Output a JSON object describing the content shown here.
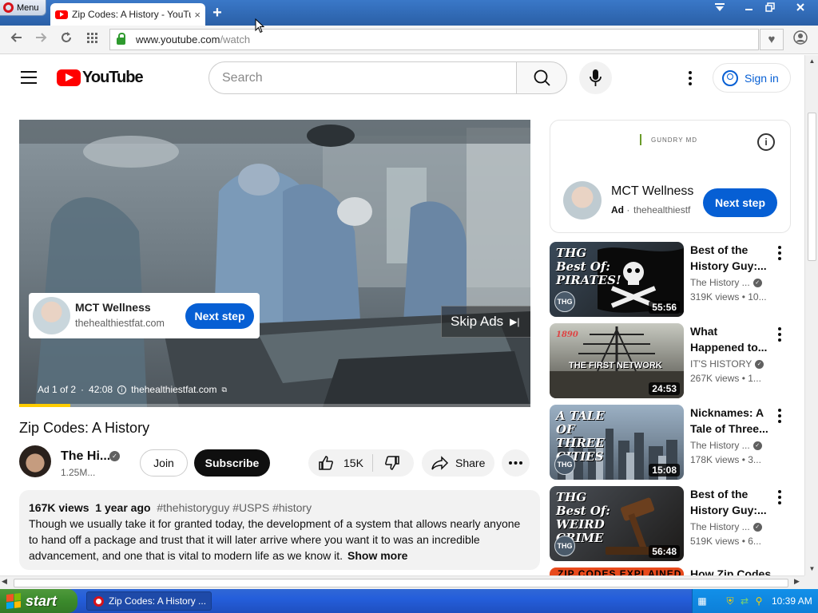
{
  "browser": {
    "menu_label": "Menu",
    "tab_title": "Zip Codes: A History - YouTu",
    "tab_close": "×",
    "new_tab": "+",
    "url_host": "www.youtube.com",
    "url_path": "/watch"
  },
  "youtube": {
    "logo_text": "YouTube",
    "search_placeholder": "Search",
    "sign_in": "Sign in"
  },
  "player": {
    "ad_card": {
      "name": "MCT Wellness",
      "site": "thehealthiestfat.com",
      "button": "Next step"
    },
    "skip_ads": "Skip Ads",
    "ad_position": "Ad 1 of 2",
    "ad_time": "42:08",
    "ad_domain": "thehealthiestfat.com",
    "ad_progress_fraction": 0.1
  },
  "video": {
    "title": "Zip Codes: A History",
    "channel_name": "The Hi...",
    "subscribers": "1.25M...",
    "join": "Join",
    "subscribe": "Subscribe",
    "likes": "15K",
    "share": "Share"
  },
  "description": {
    "views": "167K views",
    "age": "1 year ago",
    "tags": "#thehistoryguy #USPS #history",
    "text": "Though we usually take it for granted today, the development of a system that allows nearly anyone to hand off a package and trust that it will later arrive where you want it to was an incredible advancement, and one that is vital to modern life as we know it.",
    "show_more": "Show more"
  },
  "sidebar_ad": {
    "brand": "GUNDRY MD",
    "name": "MCT Wellness",
    "ad_label": "Ad",
    "site": "thehealthiestf",
    "button": "Next step"
  },
  "recommendations": [
    {
      "title_line1": "Best of the",
      "title_line2": "History Guy:...",
      "channel": "The History ...",
      "views": "319K views • 10...",
      "duration": "55:56",
      "caption": "THG Best Of: PIRATES!"
    },
    {
      "title_line1": "What",
      "title_line2": "Happened to...",
      "channel": "IT'S HISTORY",
      "views": "267K views • 1...",
      "duration": "24:53",
      "caption": "THE FIRST NETWORK"
    },
    {
      "title_line1": "Nicknames: A",
      "title_line2": "Tale of Three...",
      "channel": "The History ...",
      "views": "178K views • 3...",
      "duration": "15:08",
      "caption": "A TALE OF THREE CITIES"
    },
    {
      "title_line1": "Best of the",
      "title_line2": "History Guy:...",
      "channel": "The History ...",
      "views": "519K views • 6...",
      "duration": "56:48",
      "caption": "THG Best Of: WEIRD CRIME"
    },
    {
      "title_line1": "How Zip Codes",
      "caption": "ZIP CODES EXPLAINED"
    }
  ],
  "thumb_extras": {
    "year_1890": "1890",
    "thg_logo": "THG"
  },
  "taskbar": {
    "start": "start",
    "task_title": "Zip Codes: A History ...",
    "clock": "10:39 AM"
  },
  "colors": {
    "yt_red": "#ff0000",
    "yt_blue": "#065fd4",
    "xp_blue": "#245edb",
    "xp_green": "#3b8a2c"
  }
}
